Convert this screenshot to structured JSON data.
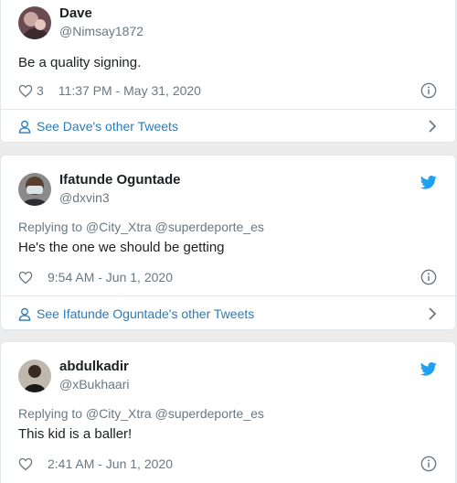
{
  "tweets": [
    {
      "author_name": "Dave",
      "handle": "@Nimsay1872",
      "replying_to": "",
      "text": "Be a quality signing.",
      "likes": "3",
      "timestamp": "11:37 PM - May 31, 2020",
      "see_more": "See Dave's other Tweets"
    },
    {
      "author_name": "Ifatunde Oguntade",
      "handle": "@dxvin3",
      "replying_to": "Replying to @City_Xtra @superdeporte_es",
      "text": "He's the one we should be getting",
      "likes": "",
      "timestamp": "9:54 AM - Jun 1, 2020",
      "see_more": "See Ifatunde Oguntade's other Tweets"
    },
    {
      "author_name": "abdulkadir",
      "handle": "@xBukhaari",
      "replying_to": "Replying to @City_Xtra @superdeporte_es",
      "text": "This kid is a baller!",
      "likes": "",
      "timestamp": "2:41 AM - Jun 1, 2020",
      "see_more": ""
    }
  ],
  "icons": {
    "like": "heart-icon",
    "info": "info-icon",
    "person": "person-icon",
    "chevron": "chevron-right-icon",
    "twitter": "twitter-bird-icon"
  },
  "colors": {
    "link": "#2b7bb9",
    "twitter_blue": "#1da1f2",
    "muted": "#697882",
    "text": "#1c2022"
  }
}
